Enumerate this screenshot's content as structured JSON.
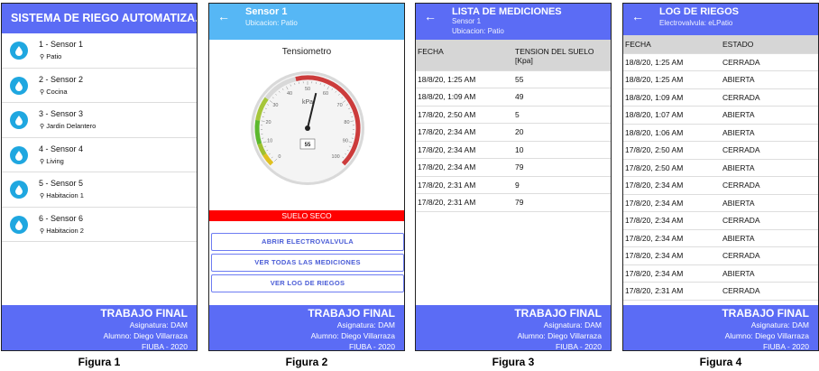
{
  "fig1": {
    "title": "SISTEMA DE RIEGO AUTOMATIZA...",
    "sensors": [
      {
        "name": "1 - Sensor 1",
        "location": "Patio"
      },
      {
        "name": "2 - Sensor 2",
        "location": "Cocina"
      },
      {
        "name": "3 - Sensor 3",
        "location": "Jardin Delantero"
      },
      {
        "name": "4 - Sensor 4",
        "location": "Living"
      },
      {
        "name": "5 - Sensor 5",
        "location": "Habitacion 1"
      },
      {
        "name": "6 - Sensor 6",
        "location": "Habitacion 2"
      }
    ]
  },
  "fig2": {
    "title": "Sensor 1",
    "subtitle": "Ubicacion: Patio",
    "gauge_title": "Tensiometro",
    "gauge_unit": "kPa",
    "gauge_value": 55,
    "gauge_value_label": "55",
    "gauge_ticks": [
      "0",
      "10",
      "20",
      "30",
      "40",
      "50",
      "60",
      "70",
      "80",
      "90",
      "100"
    ],
    "status": "SUELO SECO",
    "btn_open": "ABRIR ELECTROVALVULA",
    "btn_measurements": "VER TODAS LAS MEDICIONES",
    "btn_log": "VER LOG DE RIEGOS"
  },
  "fig3": {
    "title": "LISTA DE MEDICIONES",
    "subtitle": "Sensor 1",
    "subtitle2": "Ubicacion: Patio",
    "col_date": "FECHA",
    "col_tension": "TENSION DEL SUELO",
    "col_unit": "[Kpa]",
    "rows": [
      [
        "18/8/20, 1:25 AM",
        "55"
      ],
      [
        "18/8/20, 1:09 AM",
        "49"
      ],
      [
        "17/8/20, 2:50 AM",
        "5"
      ],
      [
        "17/8/20, 2:34 AM",
        "20"
      ],
      [
        "17/8/20, 2:34 AM",
        "10"
      ],
      [
        "17/8/20, 2:34 AM",
        "79"
      ],
      [
        "17/8/20, 2:31 AM",
        "9"
      ],
      [
        "17/8/20, 2:31 AM",
        "79"
      ]
    ]
  },
  "fig4": {
    "title": "LOG DE RIEGOS",
    "subtitle": "Electrovalvula: eLPatio",
    "col_date": "FECHA",
    "col_state": "ESTADO",
    "rows": [
      [
        "18/8/20, 1:25 AM",
        "CERRADA"
      ],
      [
        "18/8/20, 1:25 AM",
        "ABIERTA"
      ],
      [
        "18/8/20, 1:09 AM",
        "CERRADA"
      ],
      [
        "18/8/20, 1:07 AM",
        "ABIERTA"
      ],
      [
        "18/8/20, 1:06 AM",
        "ABIERTA"
      ],
      [
        "17/8/20, 2:50 AM",
        "CERRADA"
      ],
      [
        "17/8/20, 2:50 AM",
        "ABIERTA"
      ],
      [
        "17/8/20, 2:34 AM",
        "CERRADA"
      ],
      [
        "17/8/20, 2:34 AM",
        "ABIERTA"
      ],
      [
        "17/8/20, 2:34 AM",
        "CERRADA"
      ],
      [
        "17/8/20, 2:34 AM",
        "ABIERTA"
      ],
      [
        "17/8/20, 2:34 AM",
        "CERRADA"
      ],
      [
        "17/8/20, 2:34 AM",
        "ABIERTA"
      ],
      [
        "17/8/20, 2:31 AM",
        "CERRADA"
      ]
    ]
  },
  "footer": {
    "title": "TRABAJO FINAL",
    "subject": "Asignatura: DAM",
    "student": "Alumno: Diego Villarraza",
    "uni": "FIUBA - 2020"
  },
  "captions": [
    "Figura 1",
    "Figura 2",
    "Figura 3",
    "Figura 4"
  ],
  "colors": {
    "primary": "#5b6cf5",
    "light_bar": "#56b7f5",
    "status_red": "#ff0000",
    "sensor_icon": "#1fa7e0"
  }
}
